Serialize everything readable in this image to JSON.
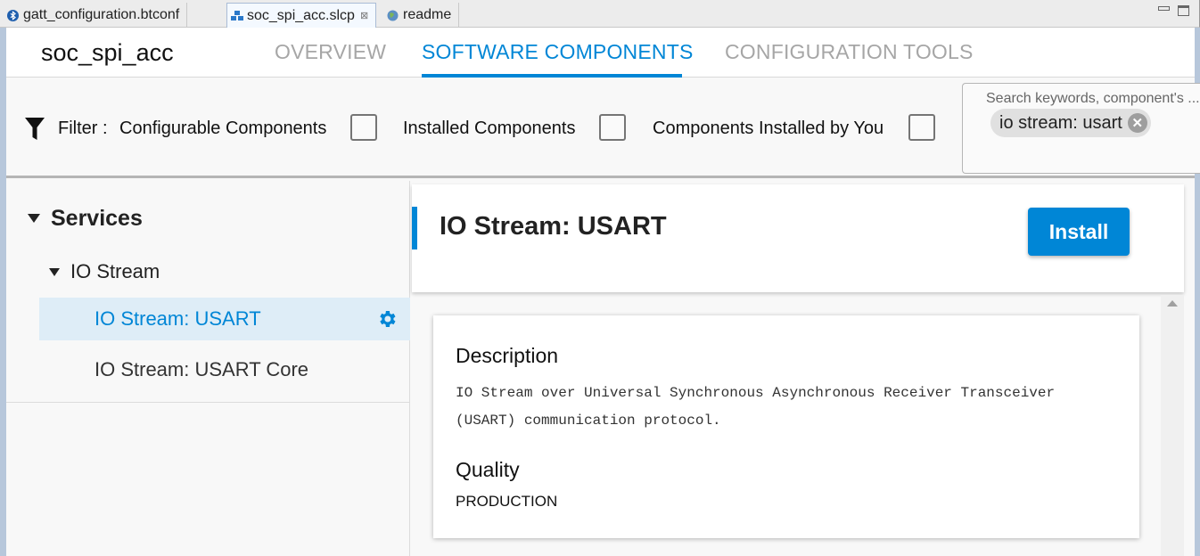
{
  "editor_tabs": [
    {
      "label": "gatt_configuration.btconf",
      "icon": "bluetooth-icon",
      "active": false
    },
    {
      "label": "soc_spi_acc.slcp",
      "icon": "project-icon",
      "active": true,
      "close_glyph": "⊠"
    },
    {
      "label": "readme",
      "icon": "globe-icon",
      "active": false
    }
  ],
  "header": {
    "project_title": "soc_spi_acc",
    "tabs": [
      {
        "label": "OVERVIEW",
        "active": false
      },
      {
        "label": "SOFTWARE COMPONENTS",
        "active": true
      },
      {
        "label": "CONFIGURATION TOOLS",
        "active": false
      }
    ]
  },
  "filter": {
    "label": "Filter :",
    "options": [
      {
        "label": "Configurable Components",
        "checked": false
      },
      {
        "label": "Installed Components",
        "checked": false
      },
      {
        "label": "Components Installed by You",
        "checked": false
      }
    ],
    "search_placeholder": "Search keywords, component's ...",
    "search_chip": "io stream: usart",
    "chip_remove_glyph": "✕"
  },
  "tree": {
    "category": "Services",
    "group": "IO Stream",
    "items": [
      {
        "label": "IO Stream: USART",
        "selected": true,
        "configurable": true
      },
      {
        "label": "IO Stream: USART Core",
        "selected": false,
        "configurable": false
      }
    ]
  },
  "detail": {
    "title": "IO Stream: USART",
    "install_label": "Install",
    "description_heading": "Description",
    "description": "IO Stream over Universal Synchronous Asynchronous Receiver Transceiver (USART) communication protocol.",
    "quality_heading": "Quality",
    "quality": "PRODUCTION"
  },
  "colors": {
    "accent": "#0086d6",
    "selected_row_bg": "#deedf7"
  }
}
